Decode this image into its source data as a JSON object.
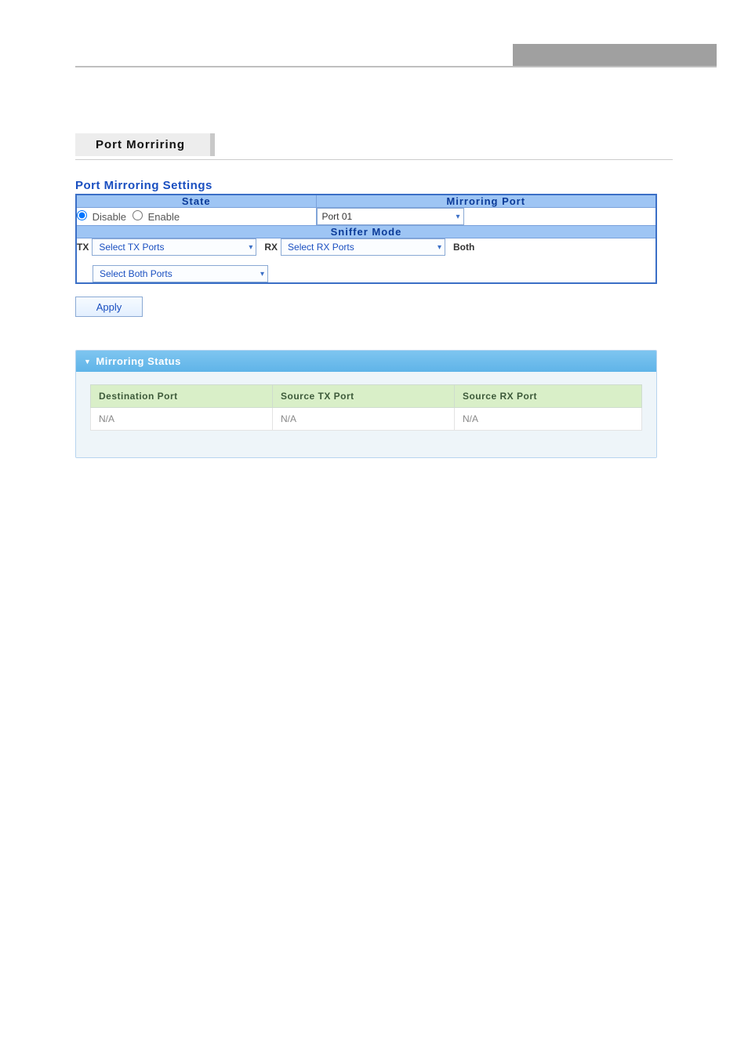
{
  "page": {
    "title": "Port Morriring"
  },
  "settings": {
    "section_title": "Port Mirroring Settings",
    "headers": {
      "state": "State",
      "mirroring_port": "Mirroring Port"
    },
    "state": {
      "disable_label": "Disable",
      "enable_label": "Enable",
      "selected": "disable"
    },
    "mirroring_port_value": "Port 01",
    "sniffer_mode_header": "Sniffer Mode",
    "tx": {
      "label": "TX",
      "placeholder": "Select TX Ports"
    },
    "rx": {
      "label": "RX",
      "placeholder": "Select RX Ports"
    },
    "both": {
      "label": "Both",
      "placeholder": "Select Both Ports"
    },
    "apply_label": "Apply"
  },
  "status": {
    "panel_title": "Mirroring Status",
    "columns": {
      "dest": "Destination Port",
      "tx": "Source TX Port",
      "rx": "Source RX Port"
    },
    "row": {
      "dest": "N/A",
      "tx": "N/A",
      "rx": "N/A"
    }
  }
}
